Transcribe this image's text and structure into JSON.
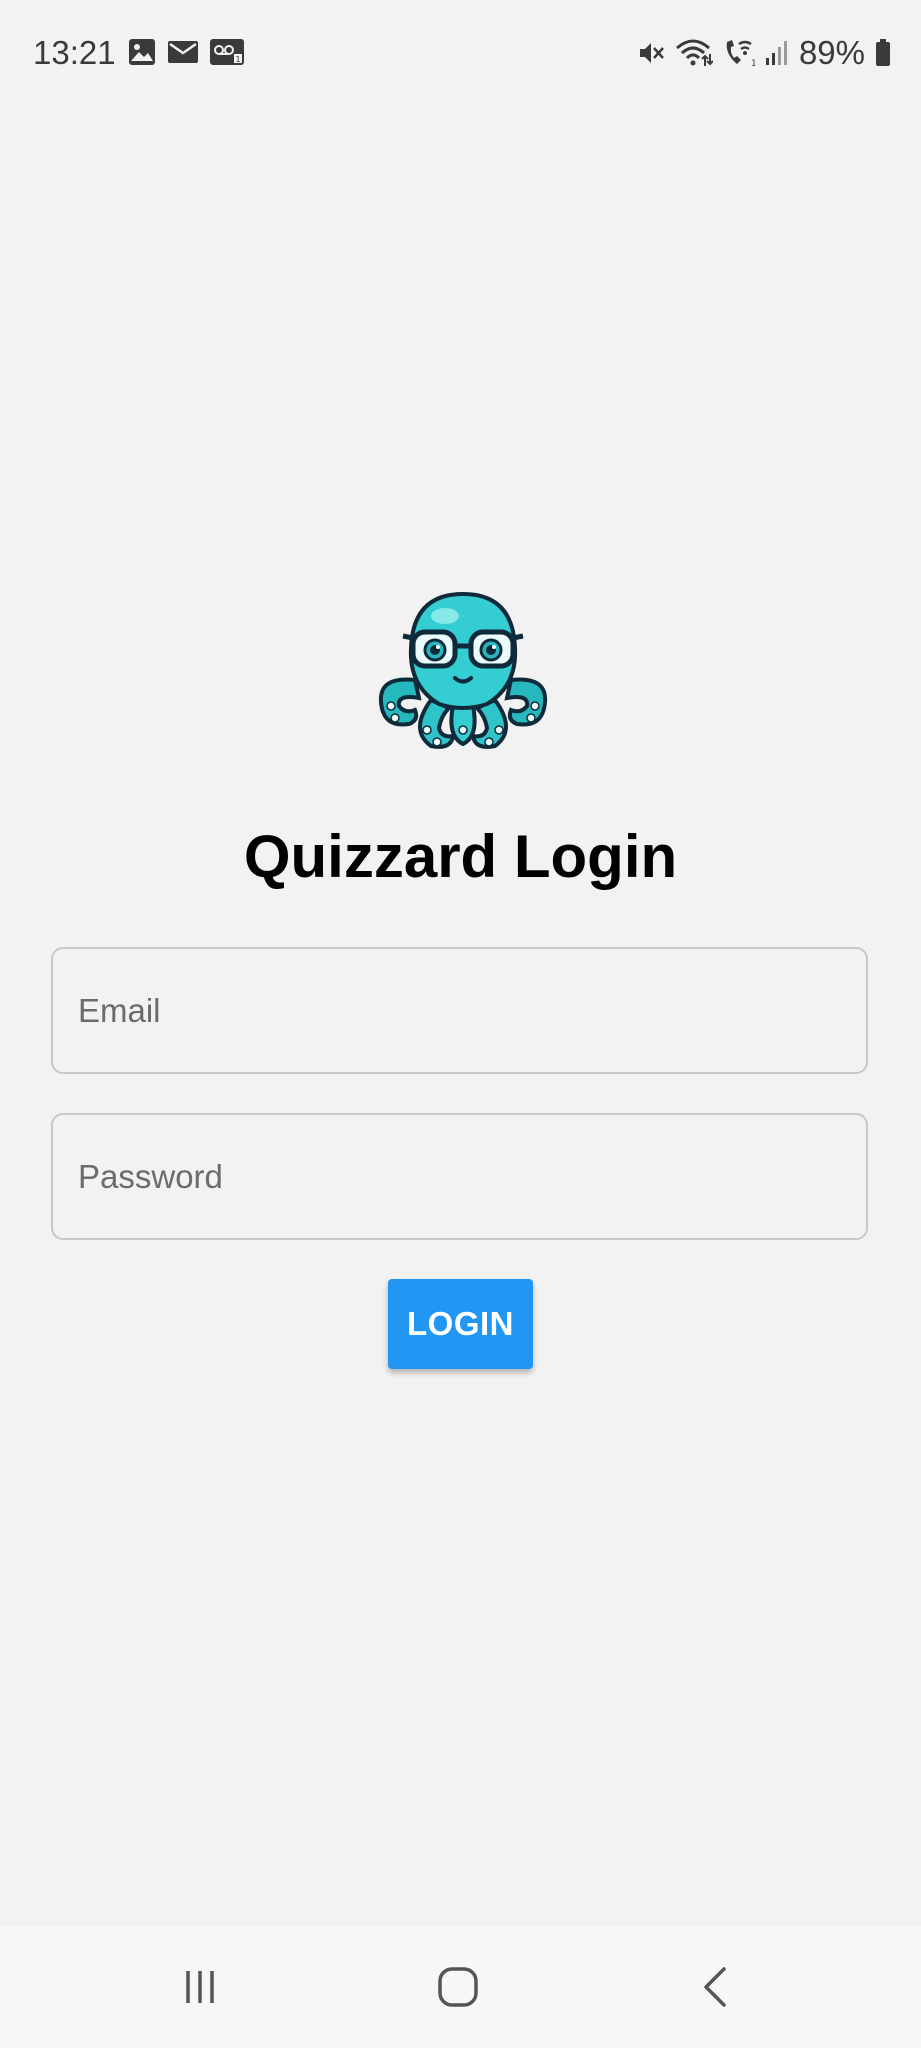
{
  "status_bar": {
    "time": "13:21",
    "left_icons": [
      "gallery-icon",
      "mail-icon",
      "voicemail-icon"
    ],
    "right_icons": [
      "mute-icon",
      "wifi-icon",
      "wifi-calling-icon",
      "signal-icon",
      "battery-icon"
    ],
    "battery_percent": "89%"
  },
  "app": {
    "logo": "octopus-logo",
    "title": "Quizzard Login",
    "email_placeholder": "Email",
    "password_placeholder": "Password",
    "login_label": "LOGIN",
    "accent_color": "#2196f3"
  },
  "nav_bar": {
    "buttons": [
      "recent-apps-icon",
      "home-icon",
      "back-icon"
    ]
  }
}
